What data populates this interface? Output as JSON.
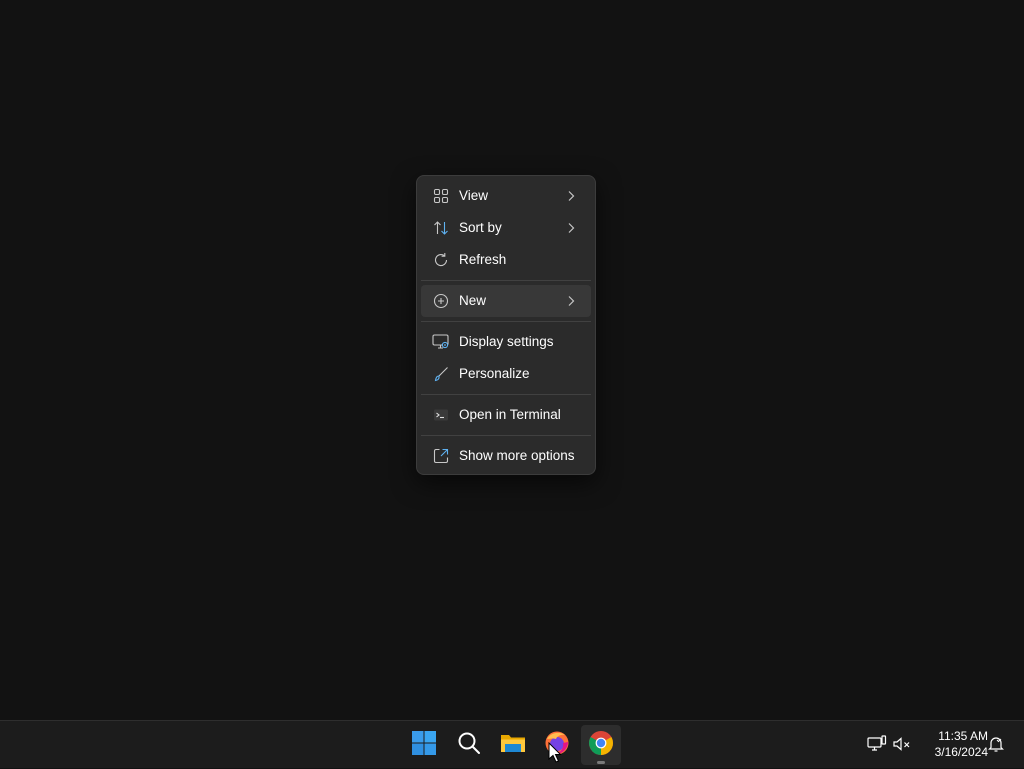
{
  "context_menu": {
    "items": [
      {
        "label": "View",
        "icon": "view-grid-icon",
        "has_submenu": true
      },
      {
        "label": "Sort by",
        "icon": "sort-icon",
        "has_submenu": true
      },
      {
        "label": "Refresh",
        "icon": "refresh-icon",
        "has_submenu": false
      },
      {
        "label": "New",
        "icon": "new-plus-icon",
        "has_submenu": true,
        "highlighted": true
      },
      {
        "label": "Display settings",
        "icon": "display-settings-icon",
        "has_submenu": false
      },
      {
        "label": "Personalize",
        "icon": "personalize-brush-icon",
        "has_submenu": false
      },
      {
        "label": "Open in Terminal",
        "icon": "terminal-icon",
        "has_submenu": false
      },
      {
        "label": "Show more options",
        "icon": "show-more-options-icon",
        "has_submenu": false
      }
    ]
  },
  "taskbar": {
    "apps": [
      {
        "name": "start",
        "icon": "windows-start-icon"
      },
      {
        "name": "search",
        "icon": "search-icon"
      },
      {
        "name": "file-explorer",
        "icon": "file-explorer-icon"
      },
      {
        "name": "firefox",
        "icon": "firefox-icon"
      },
      {
        "name": "chrome",
        "icon": "chrome-icon",
        "active": true
      }
    ],
    "tray": {
      "icons": [
        "network-icon",
        "volume-muted-icon",
        "notification-bell-icon"
      ],
      "time": "11:35 AM",
      "date": "3/16/2024"
    }
  },
  "colors": {
    "desktop_bg": "#121212",
    "menu_bg": "#2b2b2b",
    "taskbar_bg": "#1c1c1c",
    "accent_blue": "#0078d4"
  }
}
